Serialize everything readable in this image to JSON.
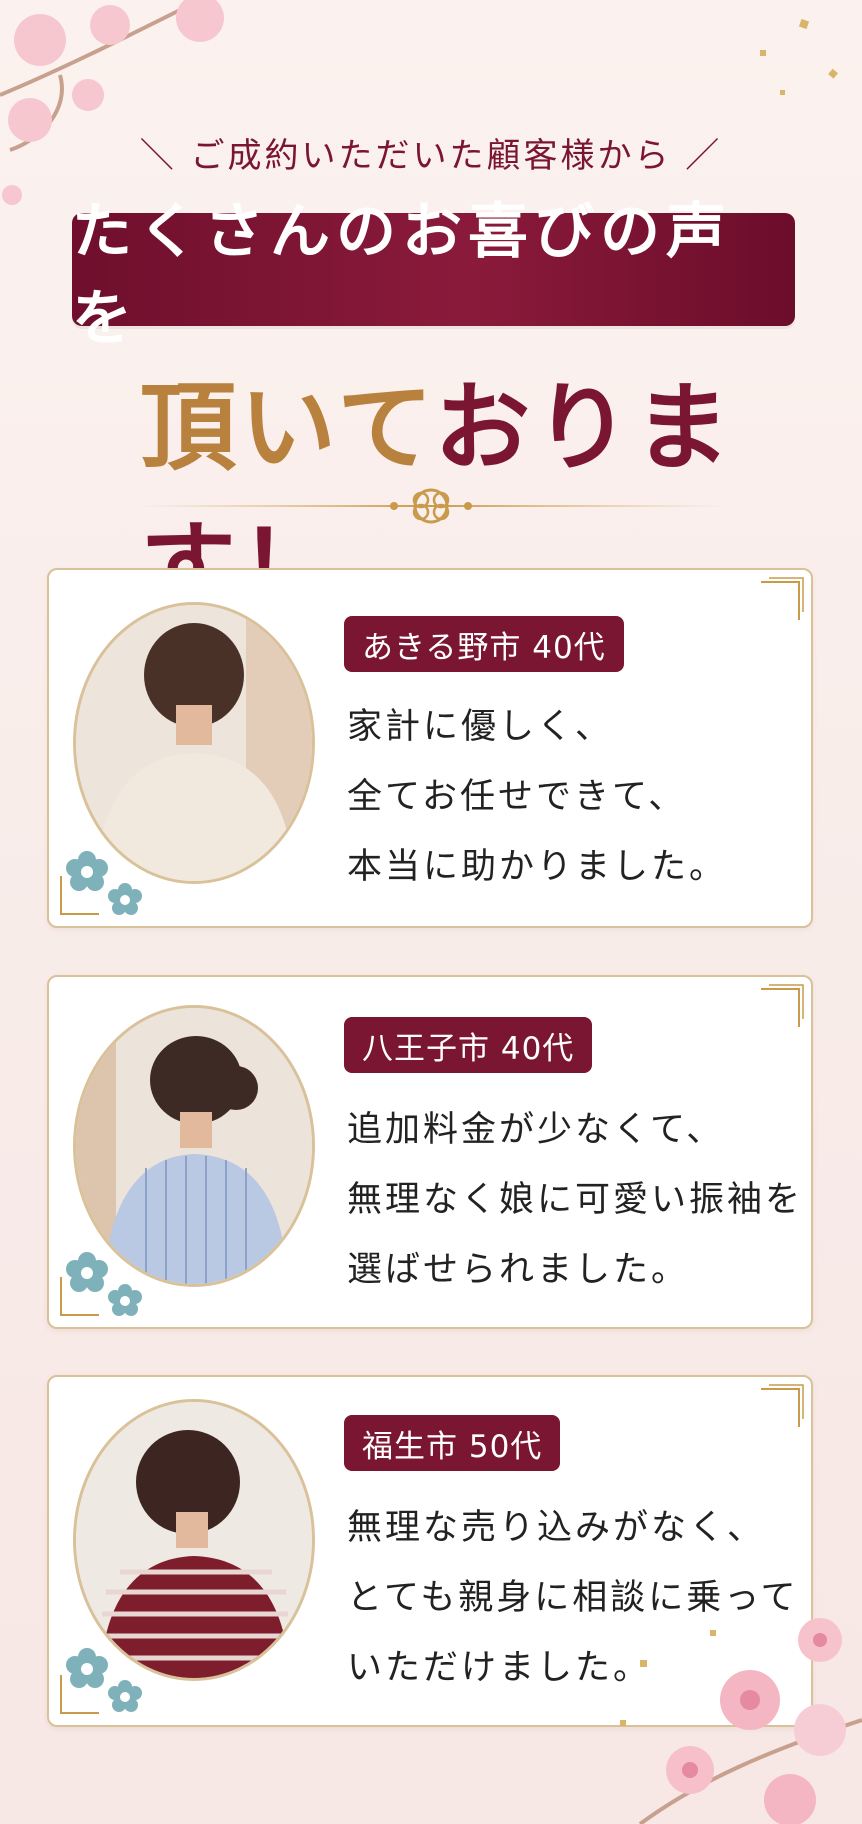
{
  "header": {
    "subtitle": "＼ ご成約いただいた顧客様から ／",
    "banner": "たくさんのお喜びの声を",
    "headline_gold": "頂いて",
    "headline_crimson": "おります！"
  },
  "colors": {
    "crimson": "#7a1532",
    "gold": "#b9813e",
    "card_border": "#d9c19a",
    "flower_blue": "#7fb1ba"
  },
  "icons": [
    "sakura-branch-icon",
    "knot-ornament-icon",
    "plum-flower-icon"
  ],
  "testimonials": [
    {
      "badge": "あきる野市 40代",
      "lines": [
        "家計に優しく、",
        "全てお任せできて、",
        "本当に助かりました。"
      ]
    },
    {
      "badge": "八王子市 40代",
      "lines": [
        "追加料金が少なくて、",
        "無理なく娘に可愛い振袖を",
        "選ばせられました。"
      ]
    },
    {
      "badge": "福生市 50代",
      "lines": [
        "無理な売り込みがなく、",
        "とても親身に相談に乗って",
        "いただけました。"
      ]
    }
  ]
}
